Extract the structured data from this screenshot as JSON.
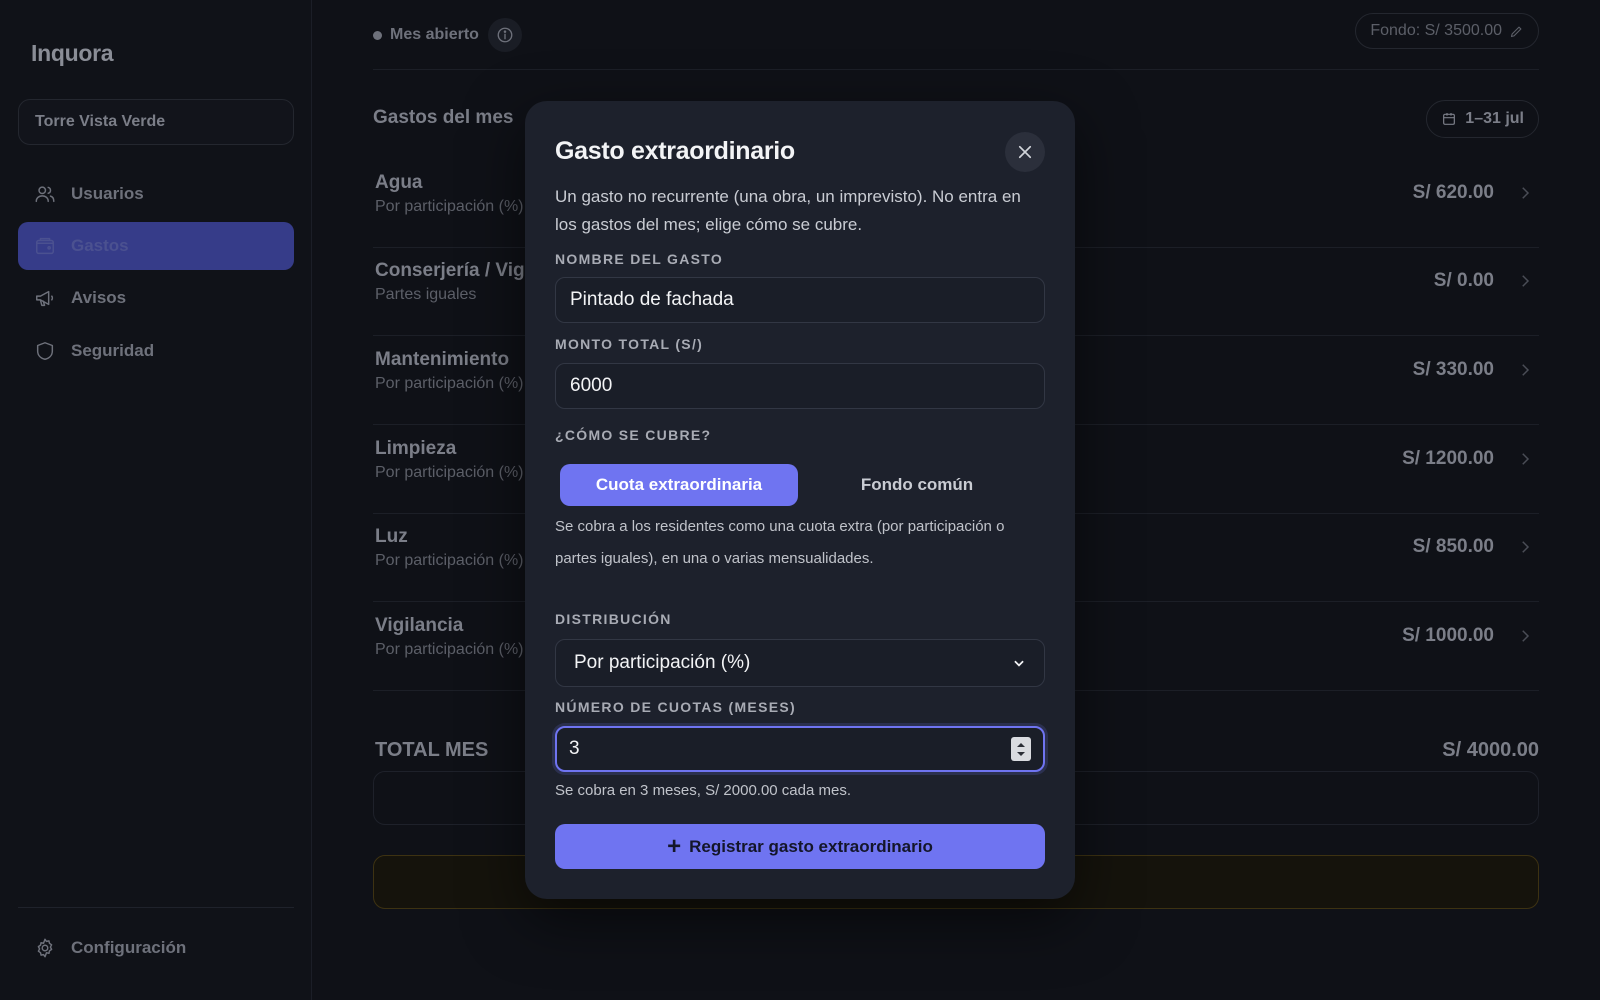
{
  "app": {
    "name": "Inquora"
  },
  "sidebar": {
    "building": "Torre Vista Verde",
    "items": [
      {
        "label": "Usuarios",
        "icon": "users-icon"
      },
      {
        "label": "Gastos",
        "icon": "wallet-icon",
        "active": true
      },
      {
        "label": "Avisos",
        "icon": "megaphone-icon"
      },
      {
        "label": "Seguridad",
        "icon": "shield-icon"
      }
    ],
    "settings": "Configuración"
  },
  "header": {
    "status": "Mes abierto",
    "fund": "Fondo: S/ 3500.00"
  },
  "expenses": {
    "title": "Gastos del mes",
    "date_range": "1–31 jul",
    "rows": [
      {
        "name": "Agua",
        "method": "Por participación (%)",
        "amount": "S/ 620.00"
      },
      {
        "name": "Conserjería / Vig",
        "method": "Partes iguales",
        "amount": "S/ 0.00"
      },
      {
        "name": "Mantenimiento",
        "method": "Por participación (%)",
        "amount": "S/ 330.00"
      },
      {
        "name": "Limpieza",
        "method": "Por participación (%)",
        "amount": "S/ 1200.00"
      },
      {
        "name": "Luz",
        "method": "Por participación (%)",
        "amount": "S/ 850.00"
      },
      {
        "name": "Vigilancia",
        "method": "Por participación (%)",
        "amount": "S/ 1000.00"
      }
    ],
    "total_label": "TOTAL MES",
    "total_value": "S/ 4000.00"
  },
  "modal": {
    "title": "Gasto extraordinario",
    "description": "Un gasto no recurrente (una obra, un imprevisto). No entra en los gastos del mes; elige cómo se cubre.",
    "name_label": "NOMBRE DEL GASTO",
    "name_value": "Pintado de fachada",
    "amount_label": "MONTO TOTAL (S/)",
    "amount_value": "6000",
    "cover_label": "¿CÓMO SE CUBRE?",
    "cover_options": [
      "Cuota extraordinaria",
      "Fondo común"
    ],
    "cover_selected": "Cuota extraordinaria",
    "cover_help": "Se cobra a los residentes como una cuota extra (por participación o partes iguales), en una o varias mensualidades.",
    "distribution_label": "DISTRIBUCIÓN",
    "distribution_value": "Por participación (%)",
    "installments_label": "NÚMERO DE CUOTAS (MESES)",
    "installments_value": "3",
    "installments_help": "Se cobra en 3 meses, S/ 2000.00 cada mes.",
    "submit": "Registrar gasto extraordinario"
  },
  "colors": {
    "accent": "#6f74f1",
    "background": "#0f1117",
    "modal": "#1d212c"
  }
}
